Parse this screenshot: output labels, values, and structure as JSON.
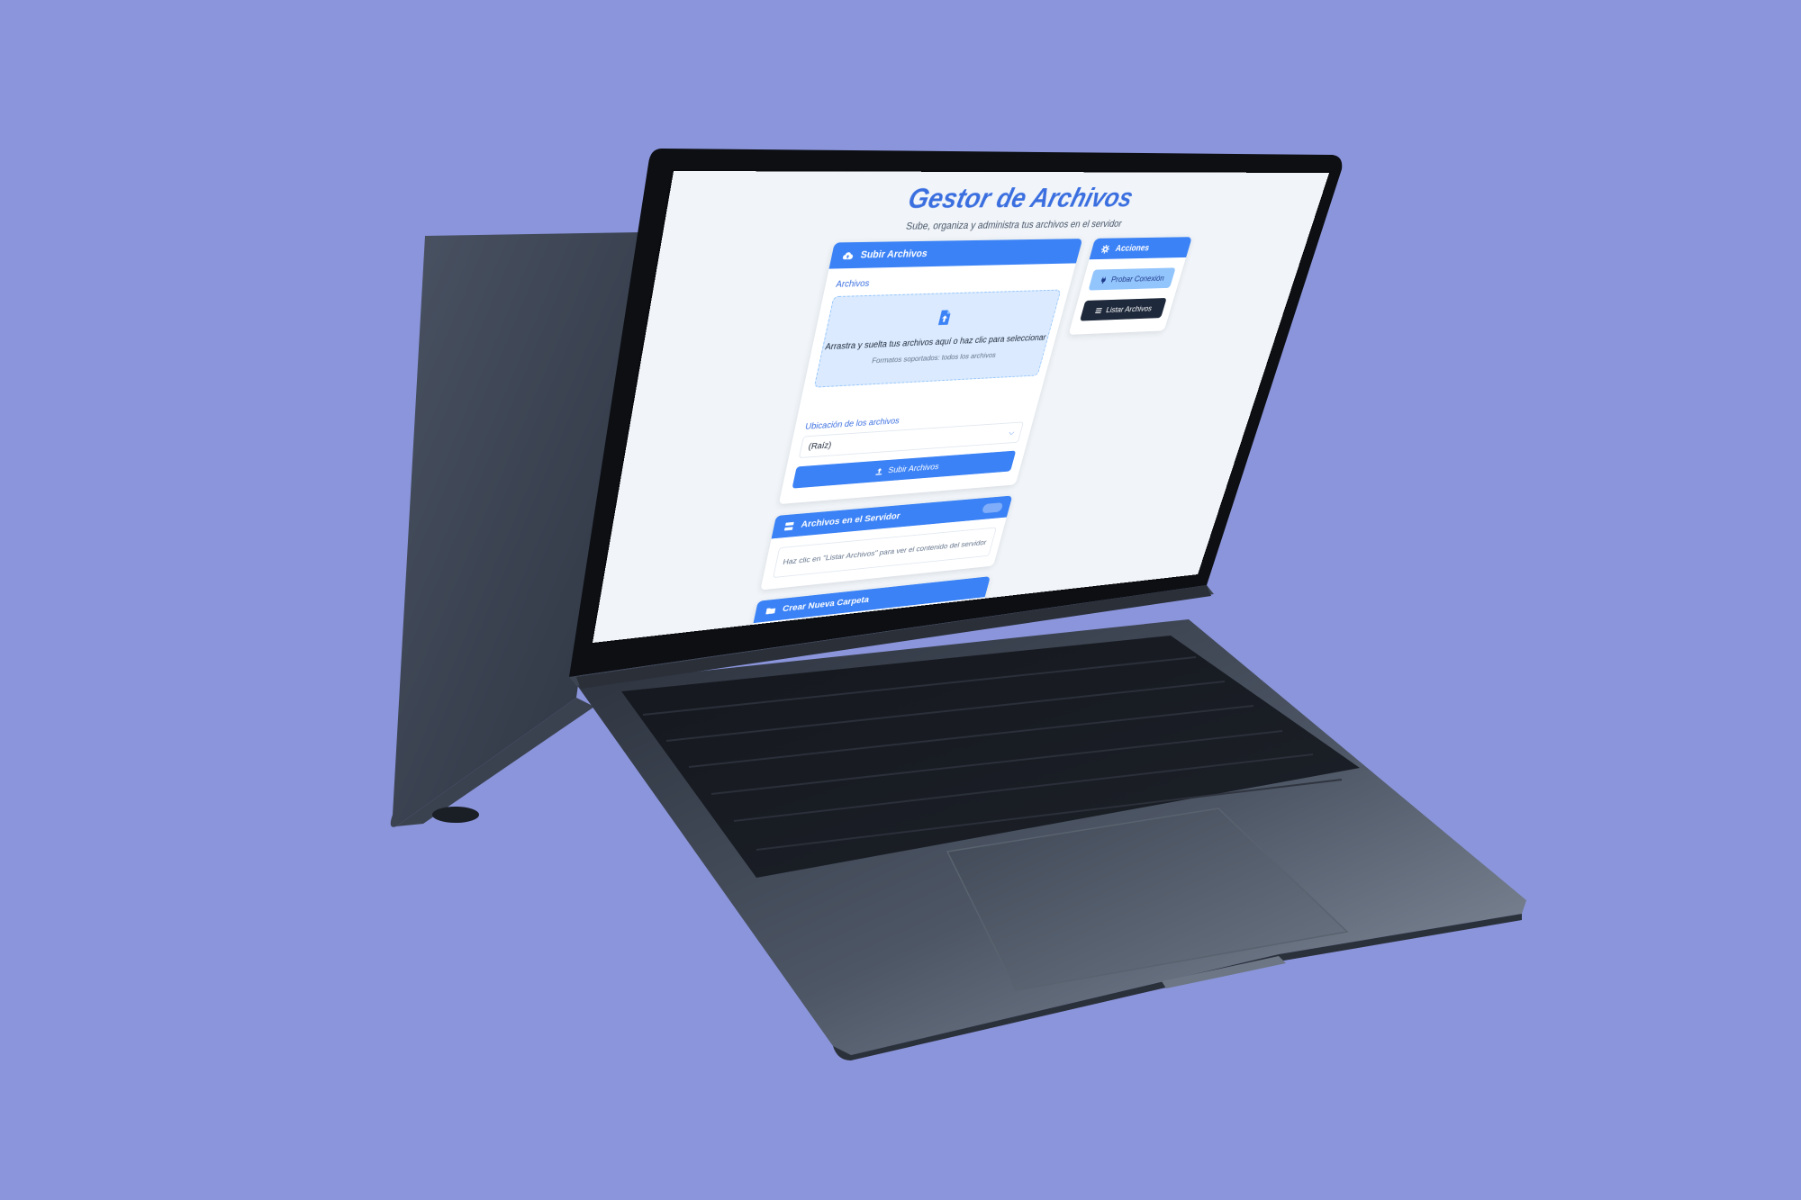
{
  "colors": {
    "background": "#8b95db",
    "accent": "#3b82f6",
    "title": "#3b6fe0",
    "dark_button": "#1e293b"
  },
  "app": {
    "title": "Gestor de Archivos",
    "subtitle": "Sube, organiza y administra tus archivos en el servidor"
  },
  "upload": {
    "header": "Subir Archivos",
    "header_icon": "cloud-upload-icon",
    "files_label": "Archivos",
    "dropzone_icon": "file-upload-icon",
    "dropzone_text": "Arrastra y suelta tus archivos aquí o haz clic para seleccionar",
    "dropzone_hint": "Formatos soportados: todos los archivos",
    "location_label": "Ubicación de los archivos",
    "location_value": "(Raíz)",
    "submit_label": "Subir Archivos",
    "submit_icon": "upload-icon"
  },
  "actions": {
    "header": "Acciones",
    "header_icon": "gear-icon",
    "test_connection_label": "Probar Conexión",
    "test_connection_icon": "plug-icon",
    "list_files_label": "Listar Archivos",
    "list_files_icon": "list-icon"
  },
  "server_files": {
    "header": "Archivos en el Servidor",
    "header_icon": "server-icon",
    "empty_message": "Haz clic en \"Listar Archivos\" para ver el contenido del servidor"
  },
  "new_folder": {
    "header": "Crear Nueva Carpeta",
    "header_icon": "folder-icon"
  }
}
